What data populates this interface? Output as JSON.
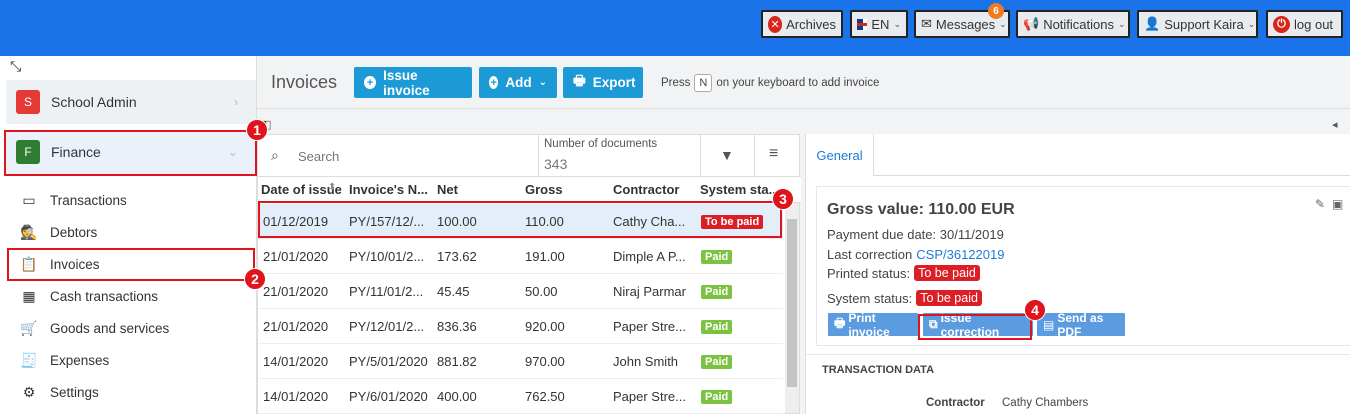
{
  "topbar": {
    "archives": "Archives",
    "lang": "EN",
    "messages": "Messages",
    "messages_count": "6",
    "notifications": "Notifications",
    "user": "Support Kaira",
    "logout": "log out"
  },
  "sidebar": {
    "modules": [
      {
        "letter": "S",
        "label": "School Admin",
        "color": "#e53935"
      },
      {
        "letter": "F",
        "label": "Finance",
        "color": "#2e7d32"
      }
    ],
    "items": [
      {
        "label": "Transactions",
        "icon": "credit-card-icon"
      },
      {
        "label": "Debtors",
        "icon": "spy-icon"
      },
      {
        "label": "Invoices",
        "icon": "clipboard-icon"
      },
      {
        "label": "Cash transactions",
        "icon": "calendar-icon"
      },
      {
        "label": "Goods and services",
        "icon": "cart-icon"
      },
      {
        "label": "Expenses",
        "icon": "receipt-icon"
      },
      {
        "label": "Settings",
        "icon": "gear-icon"
      }
    ]
  },
  "header": {
    "title": "Invoices",
    "issue_invoice": "Issue invoice",
    "add": "Add",
    "export": "Export",
    "hint_pre": "Press",
    "hint_key": "N",
    "hint_post": "on your keyboard to add invoice"
  },
  "list": {
    "search_placeholder": "Search",
    "count_label": "Number of documents",
    "count_value": "343",
    "columns": [
      "Date of issue",
      "Invoice's N...",
      "Net",
      "Gross",
      "Contractor",
      "System sta..."
    ],
    "rows": [
      {
        "date": "01/12/2019",
        "number": "PY/157/12/...",
        "net": "100.00",
        "gross": "110.00",
        "contractor": "Cathy Cha...",
        "status": "To be paid"
      },
      {
        "date": "21/01/2020",
        "number": "PY/10/01/2...",
        "net": "173.62",
        "gross": "191.00",
        "contractor": "Dimple A P...",
        "status": "Paid"
      },
      {
        "date": "21/01/2020",
        "number": "PY/11/01/2...",
        "net": "45.45",
        "gross": "50.00",
        "contractor": "Niraj Parmar",
        "status": "Paid"
      },
      {
        "date": "21/01/2020",
        "number": "PY/12/01/2...",
        "net": "836.36",
        "gross": "920.00",
        "contractor": "Paper Stre...",
        "status": "Paid"
      },
      {
        "date": "14/01/2020",
        "number": "PY/5/01/2020",
        "net": "881.82",
        "gross": "970.00",
        "contractor": "John Smith",
        "status": "Paid"
      },
      {
        "date": "14/01/2020",
        "number": "PY/6/01/2020",
        "net": "400.00",
        "gross": "762.50",
        "contractor": "Paper Stre...",
        "status": "Paid"
      }
    ]
  },
  "detail": {
    "tab": "General",
    "gross": "Gross value: 110.00 EUR",
    "due": "Payment due date: 30/11/2019",
    "last_correction_label": "Last correction",
    "last_correction_value": "CSP/36122019",
    "printed_label": "Printed status:",
    "printed_value": "To be paid",
    "system_label": "System status:",
    "system_value": "To be paid",
    "print_btn": "Print invoice",
    "correction_btn": "Issue correction",
    "pdf_btn": "Send as PDF",
    "section": "TRANSACTION DATA",
    "contractor_label": "Contractor",
    "contractor_value": "Cathy Chambers"
  },
  "annotations": [
    "1",
    "2",
    "3",
    "4"
  ],
  "colors": {
    "topbar": "#1a73e8",
    "primary_button": "#1c9ad6",
    "paid": "#7cc242",
    "to_be_paid": "#dc1f26",
    "highlight": "#e0141d"
  }
}
